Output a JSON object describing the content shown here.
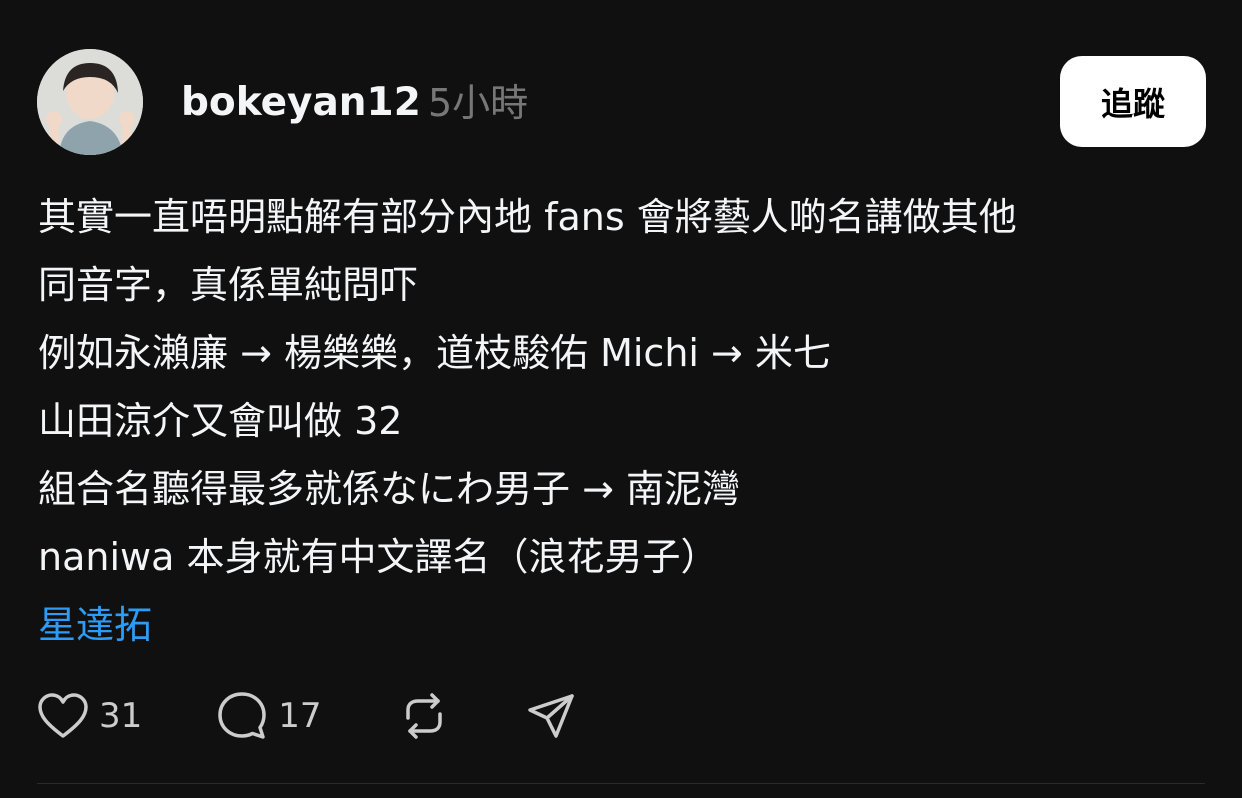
{
  "post": {
    "username": "bokeyan12",
    "timestamp": "5小時",
    "follow_label": "追蹤",
    "lines": [
      "其實一直唔明點解有部分內地 fans 會將藝人啲名講做其他",
      "同音字，真係單純問吓",
      "例如永瀨廉 → 楊樂樂，道枝駿佑 Michi → 米七",
      "山田涼介又會叫做 32",
      "組合名聽得最多就係なにわ男子 → 南泥灣",
      "naniwa 本身就有中文譯名（浪花男子）"
    ],
    "hashtag": "星達拓",
    "actions": {
      "like_count": "31",
      "reply_count": "17"
    }
  },
  "colors": {
    "background": "#101010",
    "text": "#f3f5f7",
    "muted": "#777777",
    "hashtag": "#2d9cf7",
    "button_bg": "#ffffff"
  },
  "icons": [
    "heart-icon",
    "comment-icon",
    "repost-icon",
    "share-icon"
  ]
}
